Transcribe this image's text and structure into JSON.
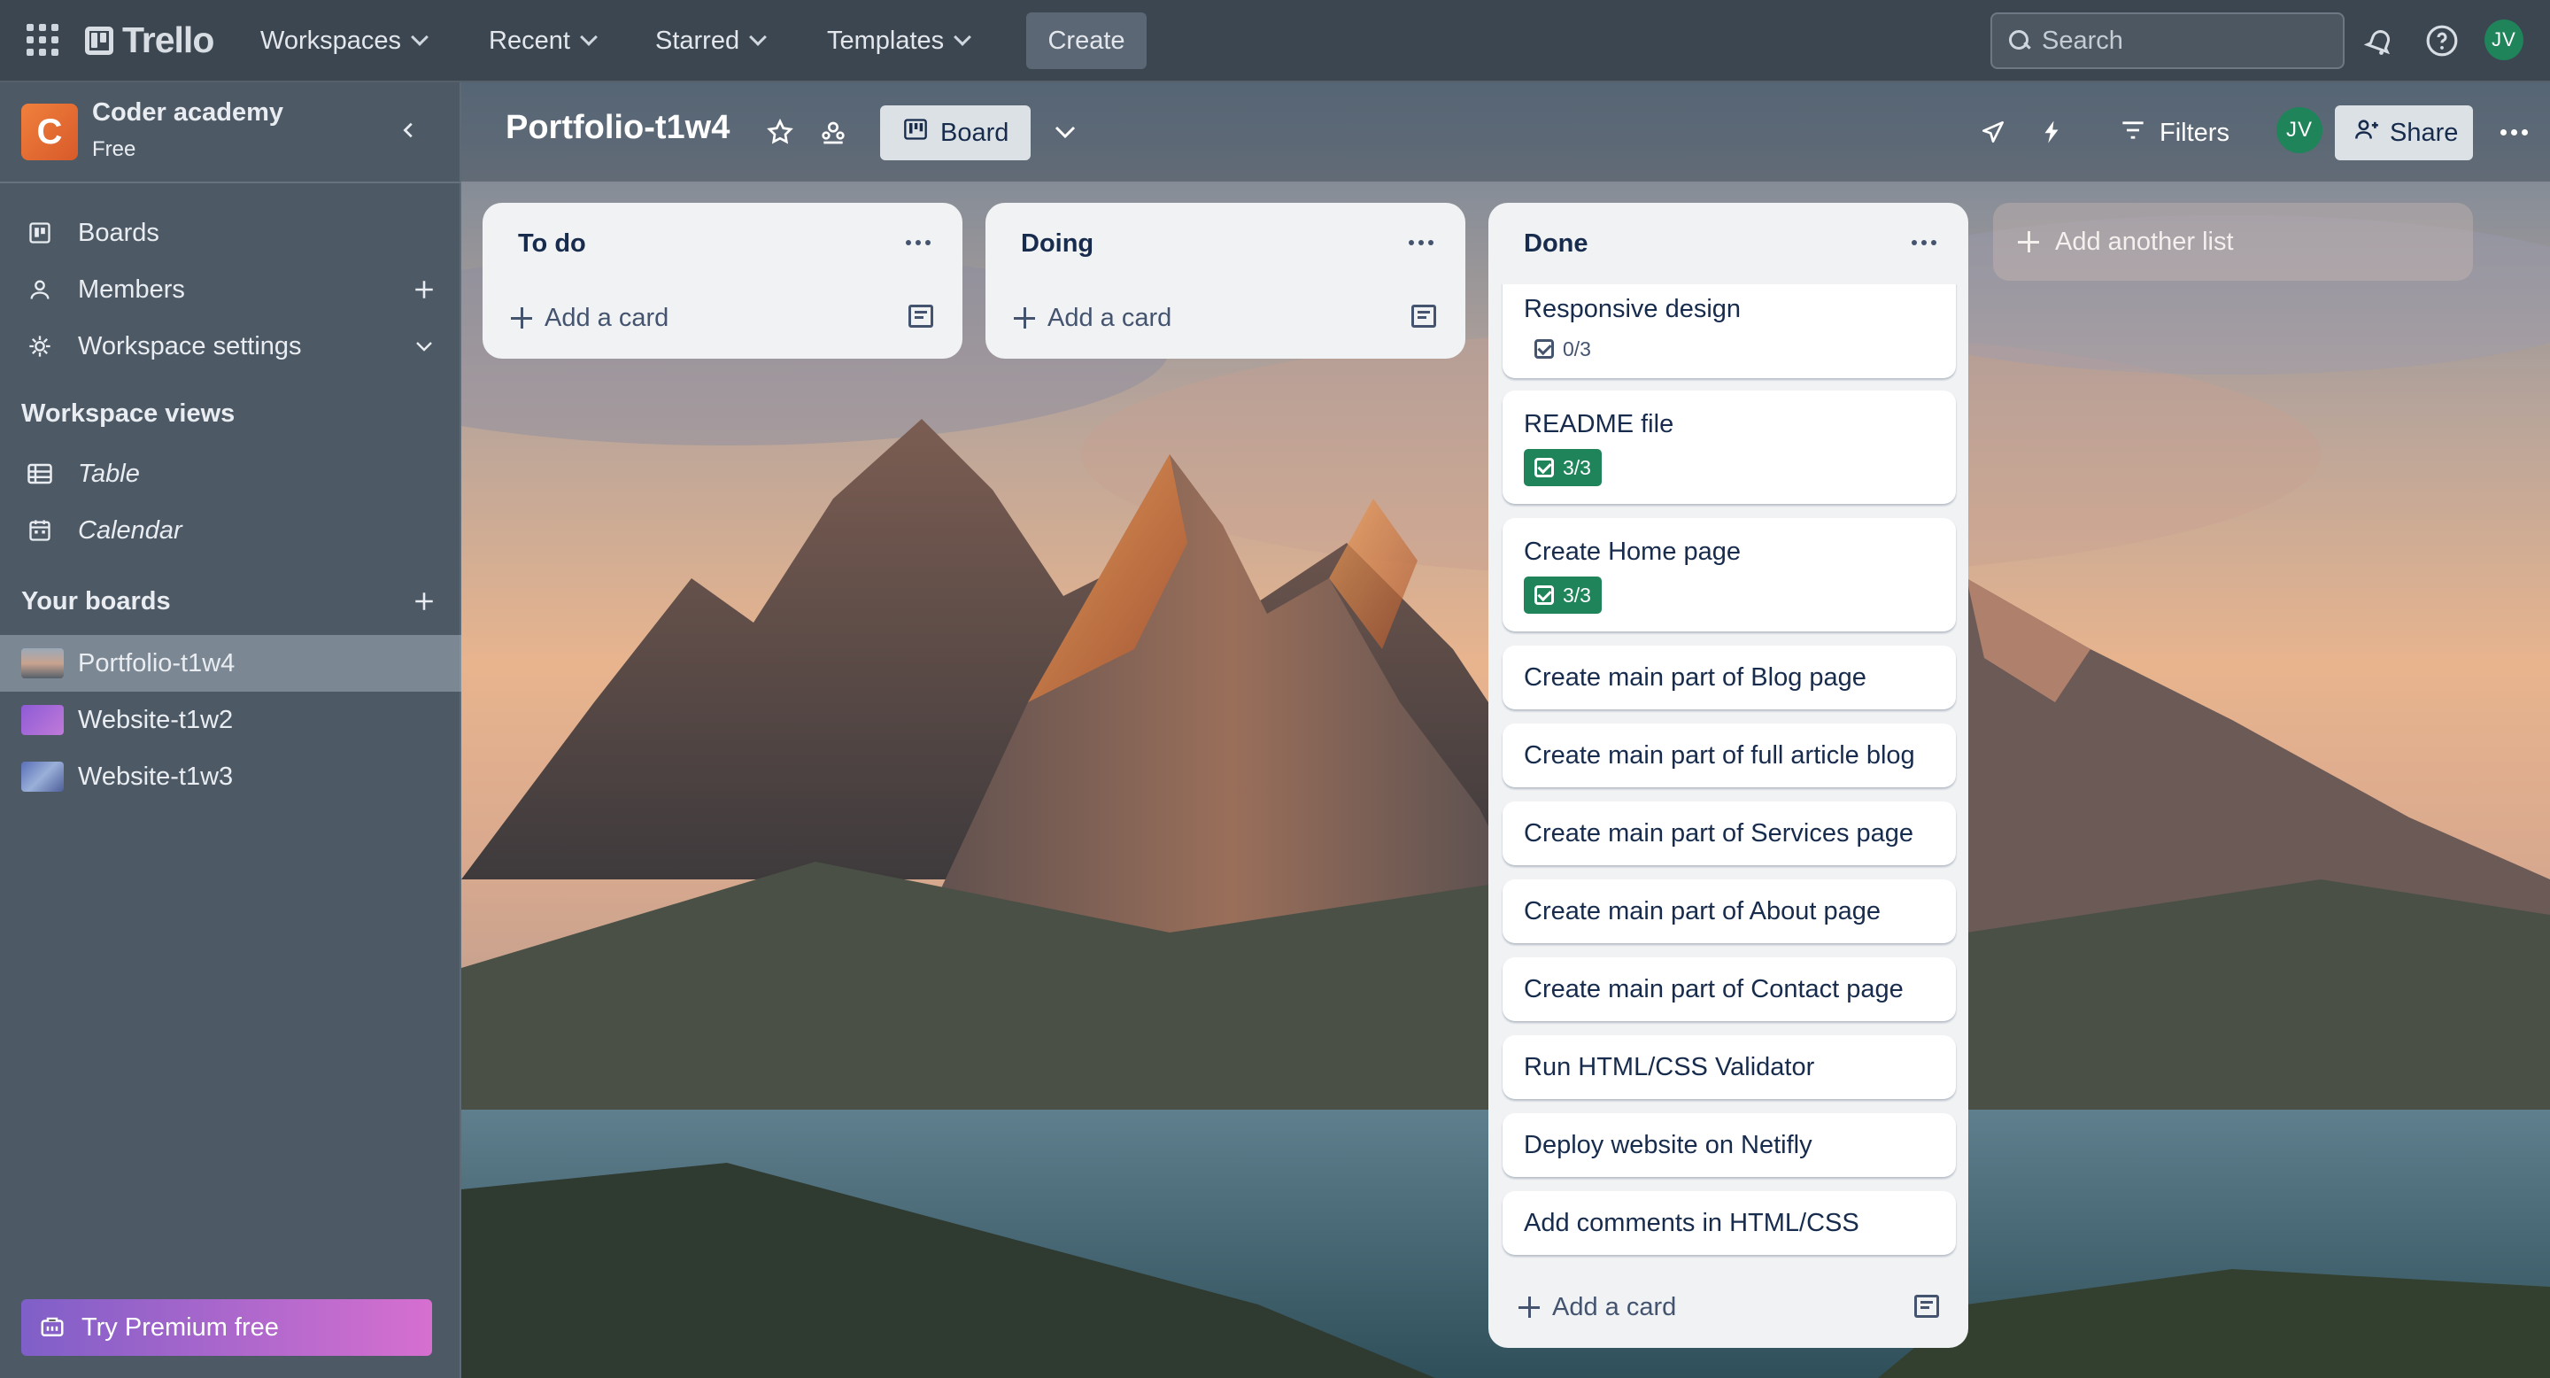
{
  "topbar": {
    "logo": "Trello",
    "menus": [
      {
        "label": "Workspaces"
      },
      {
        "label": "Recent"
      },
      {
        "label": "Starred"
      },
      {
        "label": "Templates"
      }
    ],
    "create_label": "Create",
    "search_placeholder": "Search",
    "avatar_initials": "JV"
  },
  "sidebar": {
    "workspace_initial": "C",
    "workspace_name": "Coder academy",
    "workspace_plan": "Free",
    "nav": [
      {
        "label": "Boards",
        "icon": "board-icon"
      },
      {
        "label": "Members",
        "icon": "person-icon"
      },
      {
        "label": "Workspace settings",
        "icon": "gear-icon"
      }
    ],
    "views_heading": "Workspace views",
    "views": [
      {
        "label": "Table",
        "icon": "table-icon"
      },
      {
        "label": "Calendar",
        "icon": "calendar-icon"
      }
    ],
    "boards_heading": "Your boards",
    "boards": [
      {
        "label": "Portfolio-t1w4",
        "active": true
      },
      {
        "label": "Website-t1w2",
        "active": false
      },
      {
        "label": "Website-t1w3",
        "active": false
      }
    ],
    "premium_label": "Try Premium free"
  },
  "board": {
    "title": "Portfolio-t1w4",
    "view_label": "Board",
    "filters_label": "Filters",
    "avatar_initials": "JV",
    "share_label": "Share"
  },
  "lists": [
    {
      "title": "To do",
      "add_label": "Add a card",
      "cards": []
    },
    {
      "title": "Doing",
      "add_label": "Add a card",
      "cards": []
    },
    {
      "title": "Done",
      "add_label": "Add a card",
      "cards": [
        {
          "title": "Responsive design",
          "checklist": "0/3",
          "complete": false
        },
        {
          "title": "README file",
          "checklist": "3/3",
          "complete": true
        },
        {
          "title": "Create Home page",
          "checklist": "3/3",
          "complete": true
        },
        {
          "title": "Create main part of Blog page"
        },
        {
          "title": "Create main part of full article blog"
        },
        {
          "title": "Create main part of Services page"
        },
        {
          "title": "Create main part of About page"
        },
        {
          "title": "Create main part of Contact page"
        },
        {
          "title": "Run HTML/CSS Validator"
        },
        {
          "title": "Deploy website on Netifly"
        },
        {
          "title": "Add comments in HTML/CSS"
        }
      ]
    }
  ],
  "add_list_label": "Add another list",
  "colors": {
    "topbar": "#3c4651",
    "sidebar": "#4e5b67",
    "list_bg": "#f1f2f4",
    "checklist_complete": "#1f845a",
    "premium_gradient_start": "#7f5fc8",
    "premium_gradient_end": "#d66fd0"
  }
}
